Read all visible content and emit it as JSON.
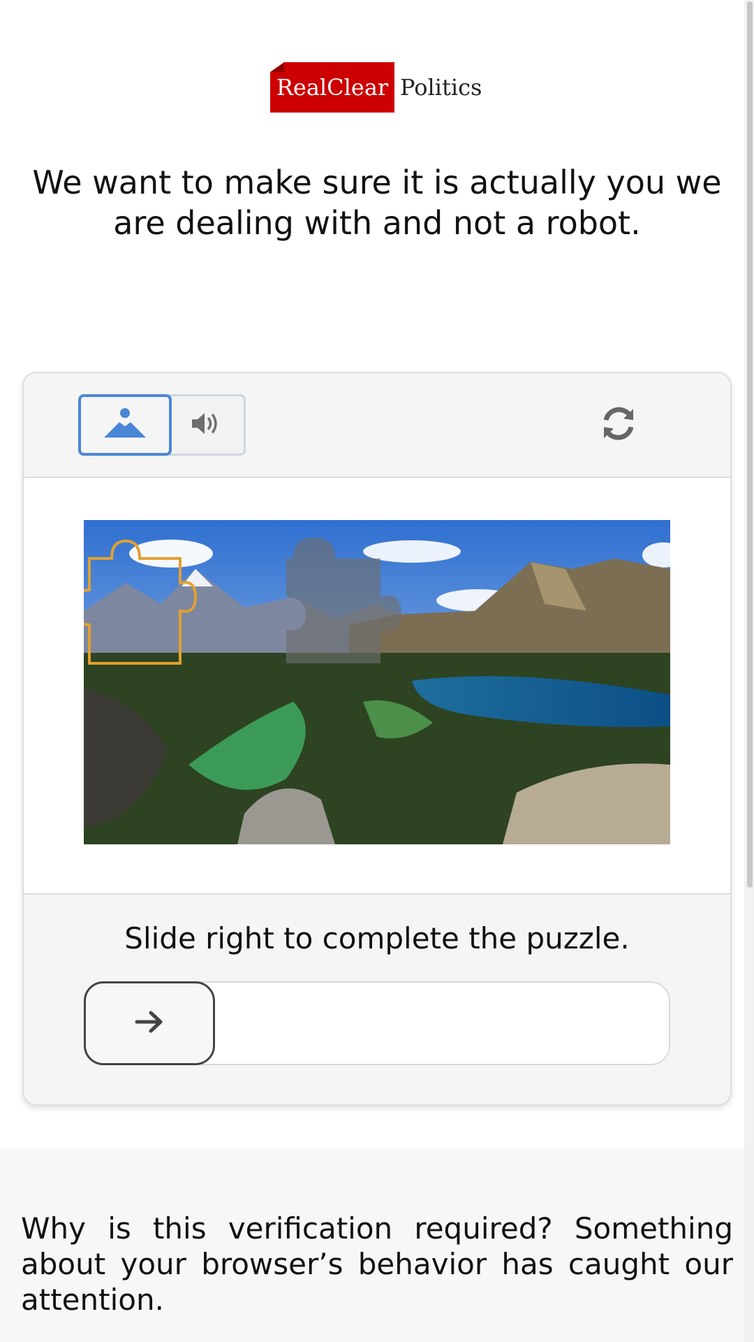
{
  "brand": {
    "logo_part1": "RealClear",
    "logo_part2": "Politics",
    "colors": {
      "brand_red": "#cc0000",
      "accent_blue": "#4a86d6",
      "puzzle_outline": "#e0a030"
    }
  },
  "headline": "We want to make sure it is actually you we are dealing with and not a robot.",
  "captcha": {
    "modes": [
      {
        "name": "image-mode",
        "icon": "image-icon",
        "selected": true
      },
      {
        "name": "audio-mode",
        "icon": "speaker-icon",
        "selected": false
      }
    ],
    "refresh_icon": "refresh-icon",
    "instruction": "Slide right to complete the puzzle.",
    "slider": {
      "handle_icon": "arrow-right-icon",
      "progress": 0
    }
  },
  "footer_text": "Why is this verification required? Something about your browser’s behavior has caught our attention."
}
